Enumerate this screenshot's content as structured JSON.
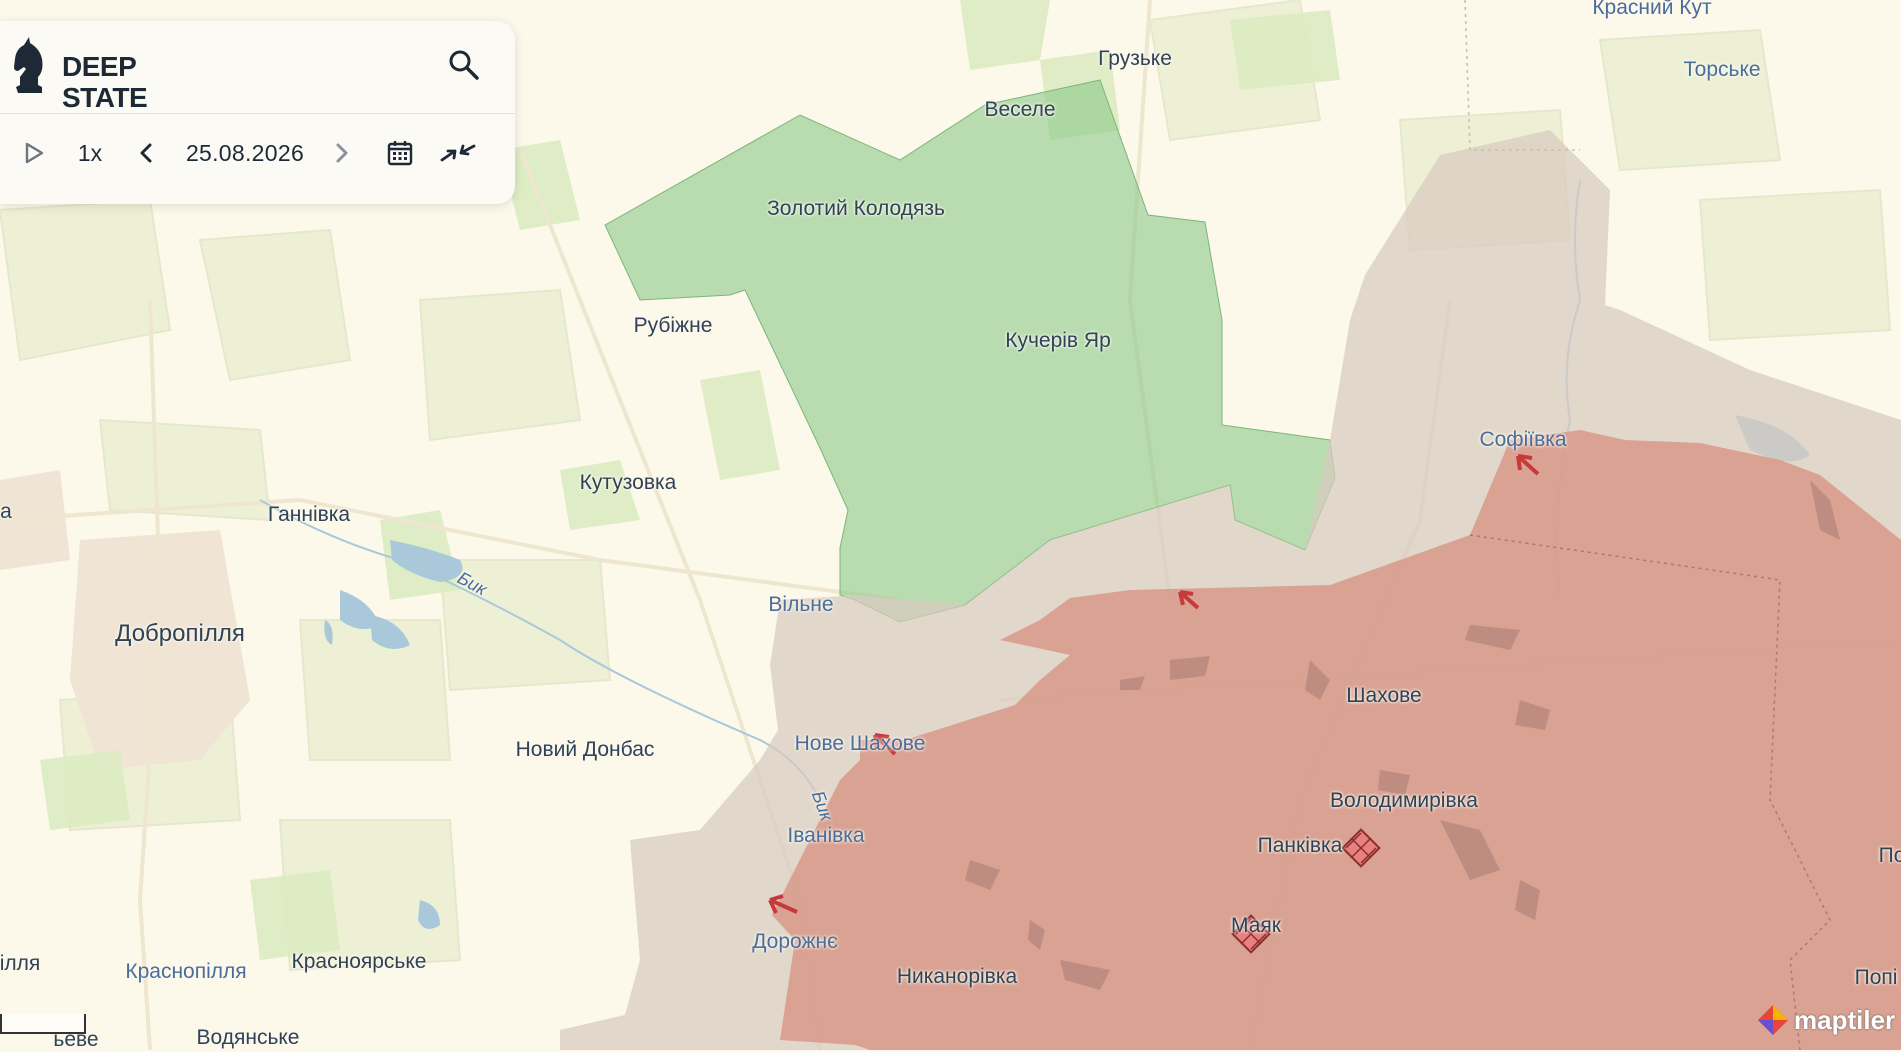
{
  "app": {
    "logo_line1": "DEEP",
    "logo_line2": "STATE"
  },
  "controls": {
    "speed": "1x",
    "date": "25.08.2026"
  },
  "icons": {
    "logo": "knight-chess-icon",
    "search": "search-icon",
    "play": "play-icon",
    "prev": "chevron-left-icon",
    "next": "chevron-right-icon",
    "calendar": "calendar-icon",
    "collapse": "collapse-arrows-icon",
    "advance": "advance-arrow-icon",
    "fortification": "fortification-icon"
  },
  "map": {
    "zones": [
      {
        "kind": "liberated",
        "color": "#8ec98b"
      },
      {
        "kind": "contested",
        "color": "#d8cbbf"
      },
      {
        "kind": "occupied",
        "color": "#d79b8b"
      }
    ],
    "places": {
      "gruzke": "Грузьке",
      "krasnyi_kut": "Красний Кут",
      "torske": "Торське",
      "vesele": "Веселе",
      "zolotyi_kolodiaz": "Золотий Колодязь",
      "rubizhne": "Рубіжне",
      "kucheriv_yar": "Кучерів Яр",
      "sofiivka": "Софіївка",
      "kutuzovka": "Кутузовка",
      "hannivka": "Ганнівка",
      "dobropillia": "Добропілля",
      "vilne": "Вільне",
      "novyi_donbas": "Новий Донбас",
      "nove_shakhove": "Нове Шахове",
      "shakhove": "Шахове",
      "volodymyrivka": "Володимирівка",
      "ivanivka": "Іванівка",
      "pankivka": "Панківка",
      "mayak": "Маяк",
      "dorozhne": "Дорожнє",
      "nykanorivka": "Никанорівка",
      "krasnopillia": "Краснопілля",
      "krasnoiarske": "Красноярське",
      "vodianske": "Водянське",
      "river_byk1": "Бик",
      "river_byk2": "Бик",
      "edge_a": "а",
      "edge_illia": "ілля",
      "edge_po": "По",
      "edge_popi": "Попі",
      "edge_beve": "ьеве"
    }
  },
  "attribution": "maptiler",
  "attribution_icon": "maptiler-logo-icon"
}
